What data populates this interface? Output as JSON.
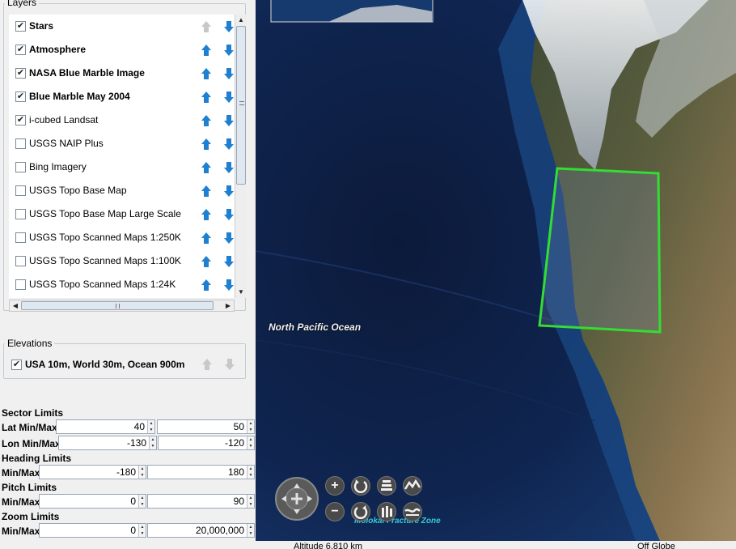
{
  "layers": {
    "title": "Layers",
    "items": [
      {
        "label": "Stars",
        "checked": true,
        "bold": true,
        "up_enabled": false,
        "down_enabled": true
      },
      {
        "label": "Atmosphere",
        "checked": true,
        "bold": true,
        "up_enabled": true,
        "down_enabled": true
      },
      {
        "label": "NASA Blue Marble Image",
        "checked": true,
        "bold": true,
        "up_enabled": true,
        "down_enabled": true
      },
      {
        "label": "Blue Marble May 2004",
        "checked": true,
        "bold": true,
        "up_enabled": true,
        "down_enabled": true
      },
      {
        "label": "i-cubed Landsat",
        "checked": true,
        "bold": false,
        "up_enabled": true,
        "down_enabled": true
      },
      {
        "label": "USGS NAIP Plus",
        "checked": false,
        "bold": false,
        "up_enabled": true,
        "down_enabled": true
      },
      {
        "label": "Bing Imagery",
        "checked": false,
        "bold": false,
        "up_enabled": true,
        "down_enabled": true
      },
      {
        "label": "USGS Topo Base Map",
        "checked": false,
        "bold": false,
        "up_enabled": true,
        "down_enabled": true
      },
      {
        "label": "USGS Topo Base Map Large Scale",
        "checked": false,
        "bold": false,
        "up_enabled": true,
        "down_enabled": true
      },
      {
        "label": "USGS Topo Scanned Maps 1:250K",
        "checked": false,
        "bold": false,
        "up_enabled": true,
        "down_enabled": true
      },
      {
        "label": "USGS Topo Scanned Maps 1:100K",
        "checked": false,
        "bold": false,
        "up_enabled": true,
        "down_enabled": true
      },
      {
        "label": "USGS Topo Scanned Maps 1:24K",
        "checked": false,
        "bold": false,
        "up_enabled": true,
        "down_enabled": true
      }
    ]
  },
  "elevations": {
    "title": "Elevations",
    "item": {
      "label": "USA 10m, World 30m, Ocean 900m",
      "checked": true
    }
  },
  "limits": {
    "sector": {
      "title": "Sector Limits",
      "lat_label": "Lat Min/Max",
      "lat_min": "40",
      "lat_max": "50",
      "lon_label": "Lon Min/Max",
      "lon_min": "-130",
      "lon_max": "-120"
    },
    "heading": {
      "title": "Heading Limits",
      "label": "Min/Max",
      "min": "-180",
      "max": "180"
    },
    "pitch": {
      "title": "Pitch Limits",
      "label": "Min/Max",
      "min": "0",
      "max": "90"
    },
    "zoom": {
      "title": "Zoom Limits",
      "label": "Min/Max",
      "min": "0",
      "max": "20,000,000"
    }
  },
  "map": {
    "ocean_label": "North Pacific Ocean",
    "fracture_label": "Molokai Fracture Zone",
    "sector_color": "#33dd33"
  },
  "status": {
    "altitude": "Altitude  6,810 km",
    "globe": "Off Globe"
  },
  "icons": {
    "checkbox_mark": "✔",
    "scroll_up": "▲",
    "scroll_down": "▼",
    "scroll_left": "◀",
    "scroll_right": "▶",
    "zoom_in": "+",
    "zoom_out": "−",
    "spin_up": "▲",
    "spin_down": "▼"
  }
}
